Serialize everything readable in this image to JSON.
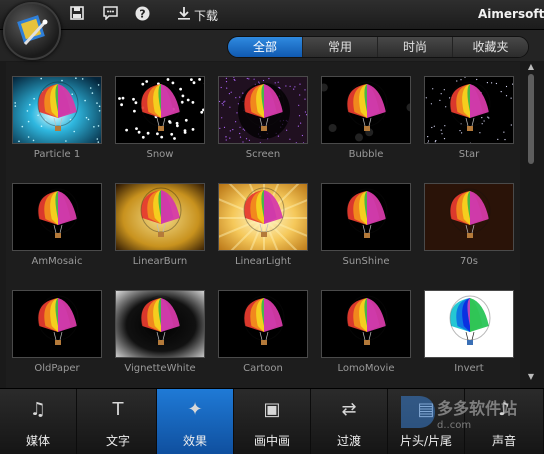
{
  "app": {
    "brand": "Aimersoft",
    "download_label": "下载"
  },
  "toolbar_icons": [
    "save-icon",
    "feedback-icon",
    "help-icon",
    "download-icon"
  ],
  "filter_tabs": [
    {
      "label": "全部",
      "active": true
    },
    {
      "label": "常用",
      "active": false
    },
    {
      "label": "时尚",
      "active": false
    },
    {
      "label": "收藏夹",
      "active": false
    }
  ],
  "effects": [
    {
      "label": "Particle 1",
      "style": "particle"
    },
    {
      "label": "Snow",
      "style": "snow"
    },
    {
      "label": "Screen",
      "style": "screen"
    },
    {
      "label": "Bubble",
      "style": "bubble"
    },
    {
      "label": "Star",
      "style": "star"
    },
    {
      "label": "AmMosaic",
      "style": "plain"
    },
    {
      "label": "LinearBurn",
      "style": "burn"
    },
    {
      "label": "LinearLight",
      "style": "light"
    },
    {
      "label": "SunShine",
      "style": "plain"
    },
    {
      "label": "70s",
      "style": "seventies"
    },
    {
      "label": "OldPaper",
      "style": "plain"
    },
    {
      "label": "VignetteWhite",
      "style": "vignette"
    },
    {
      "label": "Cartoon",
      "style": "plain"
    },
    {
      "label": "LomoMovie",
      "style": "plain"
    },
    {
      "label": "Invert",
      "style": "invert"
    }
  ],
  "bottom_tabs": [
    {
      "label": "媒体",
      "icon": "media-icon",
      "glyph": "♫",
      "active": false
    },
    {
      "label": "文字",
      "icon": "text-icon",
      "glyph": "T",
      "active": false
    },
    {
      "label": "效果",
      "icon": "effects-wand-icon",
      "glyph": "✦",
      "active": true
    },
    {
      "label": "画中画",
      "icon": "pip-icon",
      "glyph": "▣",
      "active": false
    },
    {
      "label": "过渡",
      "icon": "transition-icon",
      "glyph": "⇄",
      "active": false
    },
    {
      "label": "片头/片尾",
      "icon": "intro-credits-icon",
      "glyph": "▤",
      "active": false
    },
    {
      "label": "声音",
      "icon": "sound-icon",
      "glyph": "♪",
      "active": false
    }
  ],
  "watermark_text": "多多软件站",
  "colors": {
    "accent": "#1a6fca",
    "background": "#1d1d1d"
  }
}
